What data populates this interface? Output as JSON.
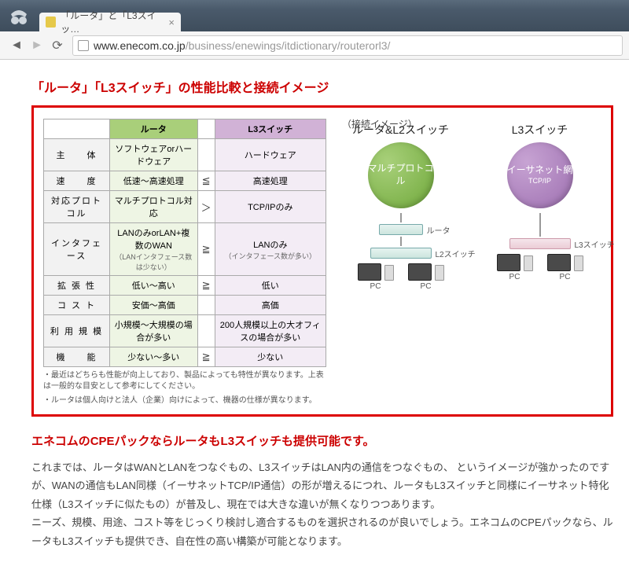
{
  "browser": {
    "tab_title": "「ルータ」と「L3スイッ…",
    "url_domain": "www.enecom.co.jp",
    "url_path": "/business/enewings/itdictionary/routerorl3/"
  },
  "page_title": "「ルータ」「L3スイッチ」の性能比較と接続イメージ",
  "table": {
    "head_router": "ルータ",
    "head_l3": "L3スイッチ",
    "rows": [
      {
        "label": "主　　体",
        "r": "ソフトウェアorハードウェア",
        "op": "",
        "l3": "ハードウェア"
      },
      {
        "label": "速　　度",
        "r": "低速～高速処理",
        "op": "≦",
        "l3": "高速処理"
      },
      {
        "label": "対応プロトコル",
        "r": "マルチプロトコル対応",
        "op": "＞",
        "l3": "TCP/IPのみ"
      },
      {
        "label": "インタフェース",
        "r": "LANのみorLAN+複数のWAN",
        "r_sub": "（LANインタフェース数は少ない）",
        "op": "≧",
        "l3": "LANのみ",
        "l3_sub": "（インタフェース数が多い）"
      },
      {
        "label": "拡 張 性",
        "r": "低い～高い",
        "op": "≧",
        "l3": "低い"
      },
      {
        "label": "コ ス ト",
        "r": "安価～高価",
        "op": "",
        "l3": "高価"
      },
      {
        "label": "利 用 規 模",
        "r": "小規模～大規模の場合が多い",
        "op": "",
        "l3": "200人規模以上の大オフィスの場合が多い"
      },
      {
        "label": "機　　能",
        "r": "少ない～多い",
        "op": "≧",
        "l3": "少ない"
      }
    ],
    "note1": "・最近はどちらも性能が向上しており、製品によっても特性が異なります。上表は一般的な目安として参考にしてください。",
    "note2": "・ルータは個人向けと法人（企業）向けによって、機器の仕様が異なります。"
  },
  "diagram": {
    "caption": "（接続イメージ）",
    "left_title": "ルータ&L2スイッチ",
    "right_title": "L3スイッチ",
    "circle_left": "マルチプロトコル",
    "circle_right": "イーサネット網",
    "circle_right_sub": "TCP/IP",
    "dev_router": "ルータ",
    "dev_l2": "L2スイッチ",
    "dev_l3": "L3スイッチ",
    "pc": "PC"
  },
  "subhead": "エネコムのCPEパックならルータもL3スイッチも提供可能です。",
  "body1": "これまでは、ルータはWANとLANをつなぐもの、L3スイッチはLAN内の通信をつなぐもの、 というイメージが強かったのですが、WANの通信もLAN同様（イーサネットTCP/IP通信）の形が増えるにつれ、ルータもL3スイッチと同様にイーサネット特化仕様（L3スイッチに似たもの）が普及し、現在では大きな違いが無くなりつつあります。",
  "body2": "ニーズ、規模、用途、コスト等をじっくり検討し適合するものを選択されるのが良いでしょう。エネコムのCPEパックなら、ルータもL3スイッチも提供でき、自在性の高い構築が可能となります。"
}
